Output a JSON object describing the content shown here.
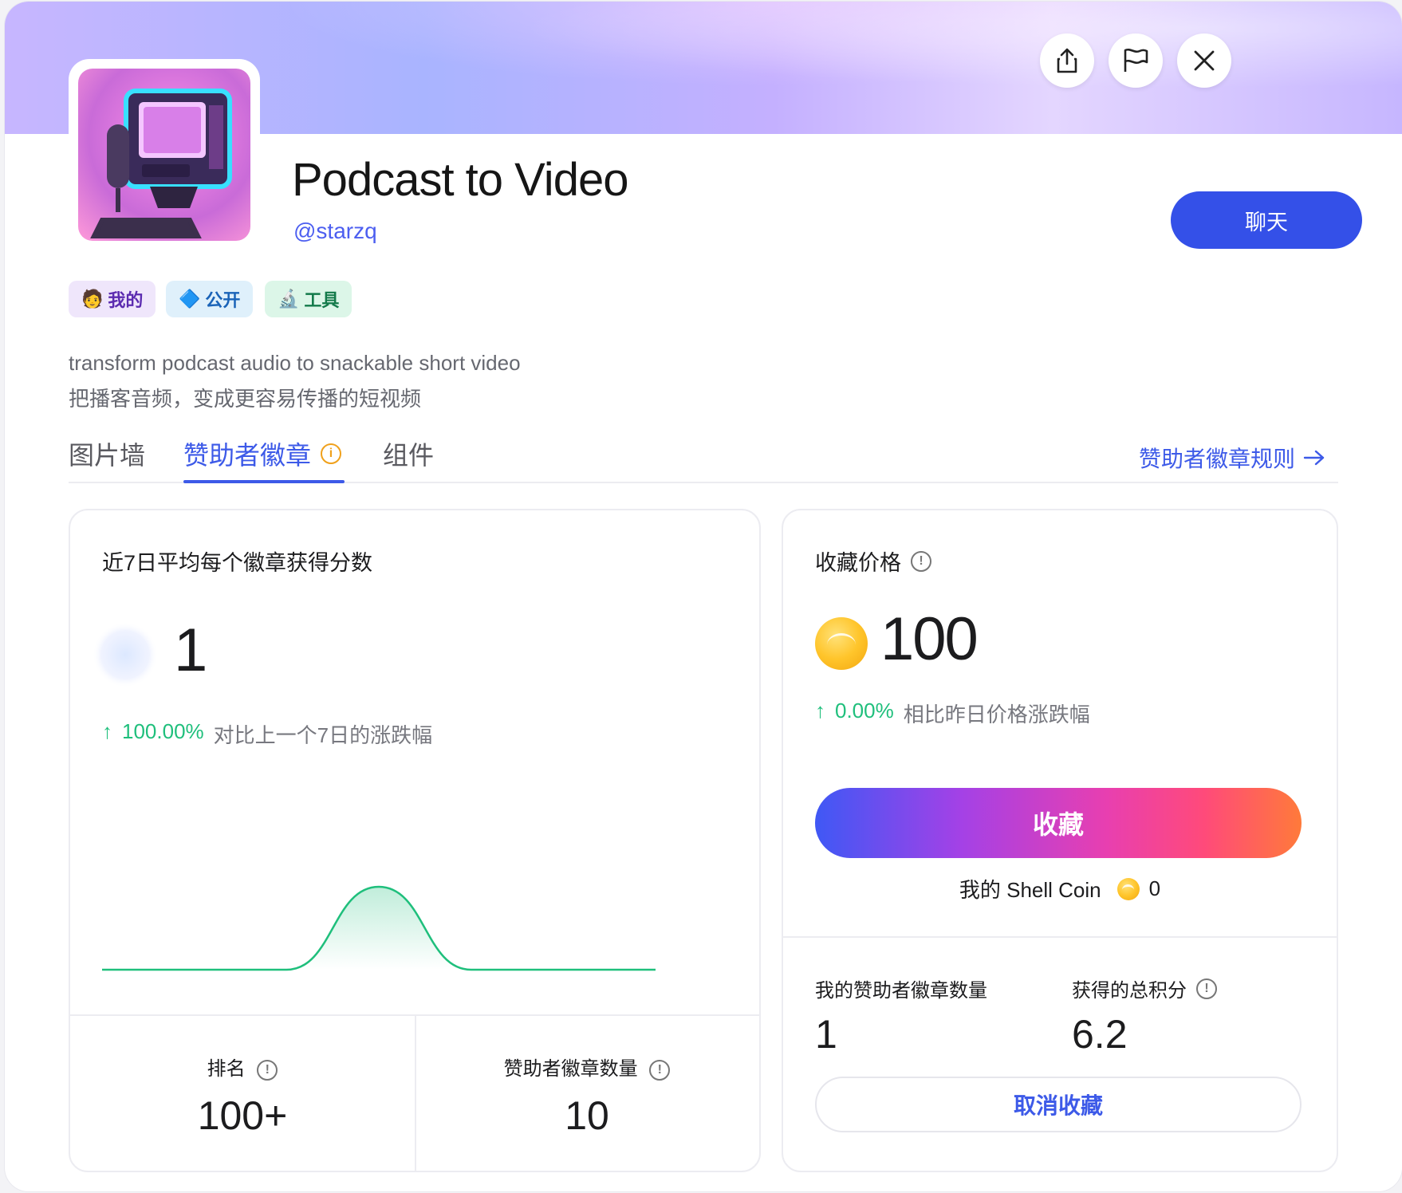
{
  "app": {
    "title": "Podcast to Video",
    "handle": "@starzq",
    "chat_label": "聊天",
    "description_en": "transform podcast audio to snackable short video",
    "description_zh": "把播客音频，变成更容易传播的短视频"
  },
  "tags": [
    {
      "icon": "🧑",
      "label": "我的",
      "bg": "#efe6fb",
      "color": "#5b2bb0"
    },
    {
      "icon": "🔷",
      "label": "公开",
      "bg": "#dff0fb",
      "color": "#1a63b8"
    },
    {
      "icon": "🔬",
      "label": "工具",
      "bg": "#dcf6e8",
      "color": "#137a4a"
    }
  ],
  "tabs": {
    "gallery": "图片墙",
    "sponsor_badge": "赞助者徽章",
    "widgets": "组件",
    "rules_link": "赞助者徽章规则"
  },
  "score_card": {
    "title": "近7日平均每个徽章获得分数",
    "value": "1",
    "change": "100.00%",
    "change_label": "对比上一个7日的涨跌幅",
    "rank_label": "排名",
    "rank_value": "100+",
    "badge_count_label": "赞助者徽章数量",
    "badge_count_value": "10"
  },
  "chart_data": {
    "type": "area",
    "x": [
      0,
      1,
      2,
      3,
      4,
      5,
      6
    ],
    "values": [
      0,
      0,
      0,
      1,
      0,
      0,
      0
    ],
    "color": "#1fbf7c"
  },
  "price_card": {
    "title": "收藏价格",
    "price": "100",
    "change": "0.00%",
    "change_label": "相比昨日价格涨跌幅",
    "collect_label": "收藏",
    "shell_coin_label": "我的 Shell Coin",
    "shell_coin_value": "0",
    "my_badges_label": "我的赞助者徽章数量",
    "my_badges_value": "1",
    "total_points_label": "获得的总积分",
    "total_points_value": "6.2",
    "cancel_label": "取消收藏"
  },
  "colors": {
    "accent": "#3d5ae8",
    "positive": "#1fbf7c"
  }
}
